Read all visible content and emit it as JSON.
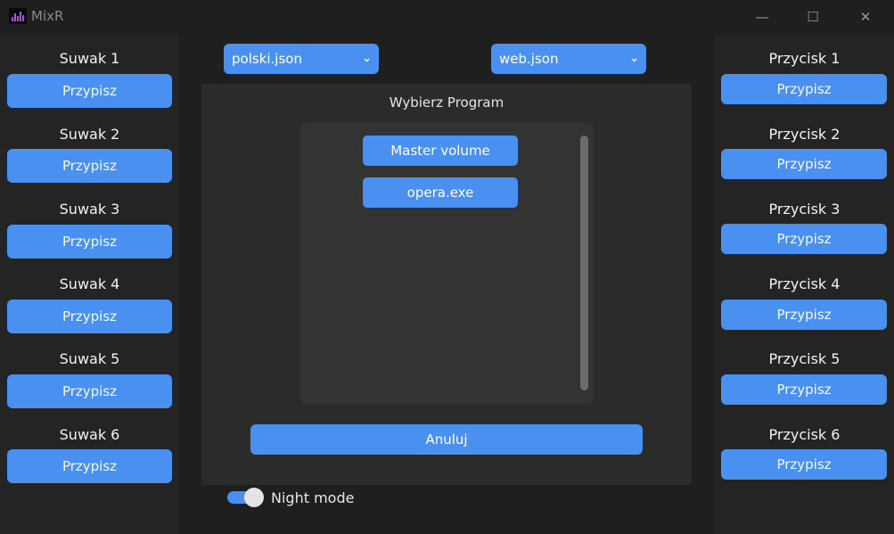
{
  "window": {
    "title": "MixR",
    "minimize_glyph": "—",
    "maximize_glyph": "☐",
    "close_glyph": "✕"
  },
  "left": {
    "sliders": [
      {
        "label": "Suwak 1",
        "button": "Przypisz"
      },
      {
        "label": "Suwak 2",
        "button": "Przypisz"
      },
      {
        "label": "Suwak 3",
        "button": "Przypisz"
      },
      {
        "label": "Suwak 4",
        "button": "Przypisz"
      },
      {
        "label": "Suwak 5",
        "button": "Przypisz"
      },
      {
        "label": "Suwak 6",
        "button": "Przypisz"
      }
    ]
  },
  "right": {
    "buttons": [
      {
        "label": "Przycisk 1",
        "button": "Przypisz"
      },
      {
        "label": "Przycisk 2",
        "button": "Przypisz"
      },
      {
        "label": "Przycisk 3",
        "button": "Przypisz"
      },
      {
        "label": "Przycisk 4",
        "button": "Przypisz"
      },
      {
        "label": "Przycisk 5",
        "button": "Przypisz"
      },
      {
        "label": "Przycisk 6",
        "button": "Przypisz"
      }
    ]
  },
  "center": {
    "language_dropdown": {
      "value": "polski.json",
      "chevron": "⌄"
    },
    "profile_dropdown": {
      "value": "web.json",
      "chevron": "⌄"
    },
    "program_picker": {
      "title": "Wybierz Program",
      "items": [
        "Master volume",
        "opera.exe"
      ],
      "cancel": "Anuluj"
    },
    "night_mode": {
      "label": "Night mode",
      "on": true
    }
  },
  "colors": {
    "accent": "#4a90f0",
    "background": "#1f1f1f",
    "panel": "#2b2b2b",
    "side_panel": "#242424"
  },
  "icons": {
    "app": "equalizer-icon",
    "minimize": "minimize-icon",
    "maximize": "maximize-icon",
    "close": "close-icon",
    "dropdown": "chevron-down-icon"
  }
}
